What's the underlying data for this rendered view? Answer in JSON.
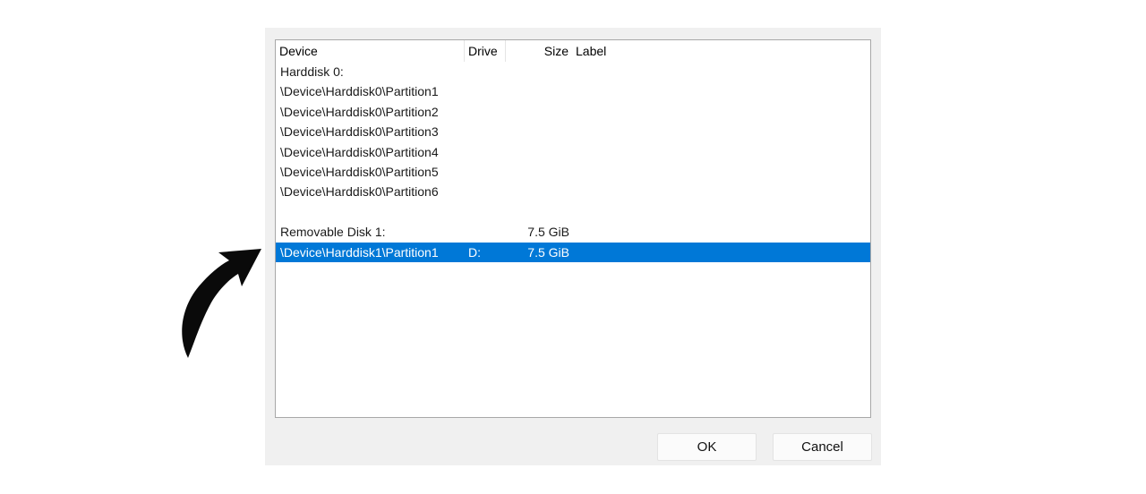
{
  "columns": {
    "device": "Device",
    "drive": "Drive",
    "size": "Size",
    "label": "Label"
  },
  "rows": [
    {
      "device": "Harddisk 0:",
      "drive": "",
      "size": "",
      "label": "",
      "selected": false
    },
    {
      "device": "\\Device\\Harddisk0\\Partition1",
      "drive": "",
      "size": "",
      "label": "",
      "selected": false
    },
    {
      "device": "\\Device\\Harddisk0\\Partition2",
      "drive": "",
      "size": "",
      "label": "",
      "selected": false
    },
    {
      "device": "\\Device\\Harddisk0\\Partition3",
      "drive": "",
      "size": "",
      "label": "",
      "selected": false
    },
    {
      "device": "\\Device\\Harddisk0\\Partition4",
      "drive": "",
      "size": "",
      "label": "",
      "selected": false
    },
    {
      "device": "\\Device\\Harddisk0\\Partition5",
      "drive": "",
      "size": "",
      "label": "",
      "selected": false
    },
    {
      "device": "\\Device\\Harddisk0\\Partition6",
      "drive": "",
      "size": "",
      "label": "",
      "selected": false
    },
    {
      "device": "",
      "drive": "",
      "size": "",
      "label": "",
      "selected": false
    },
    {
      "device": "Removable Disk 1:",
      "drive": "",
      "size": "7.5 GiB",
      "label": "",
      "selected": false
    },
    {
      "device": "\\Device\\Harddisk1\\Partition1",
      "drive": "D:",
      "size": "7.5 GiB",
      "label": "",
      "selected": true
    }
  ],
  "buttons": {
    "ok": "OK",
    "cancel": "Cancel"
  },
  "colors": {
    "selection": "#0078d7",
    "dialog_bg": "#f0f0f0"
  },
  "icons": {
    "pointer": "curved-arrow-icon"
  }
}
